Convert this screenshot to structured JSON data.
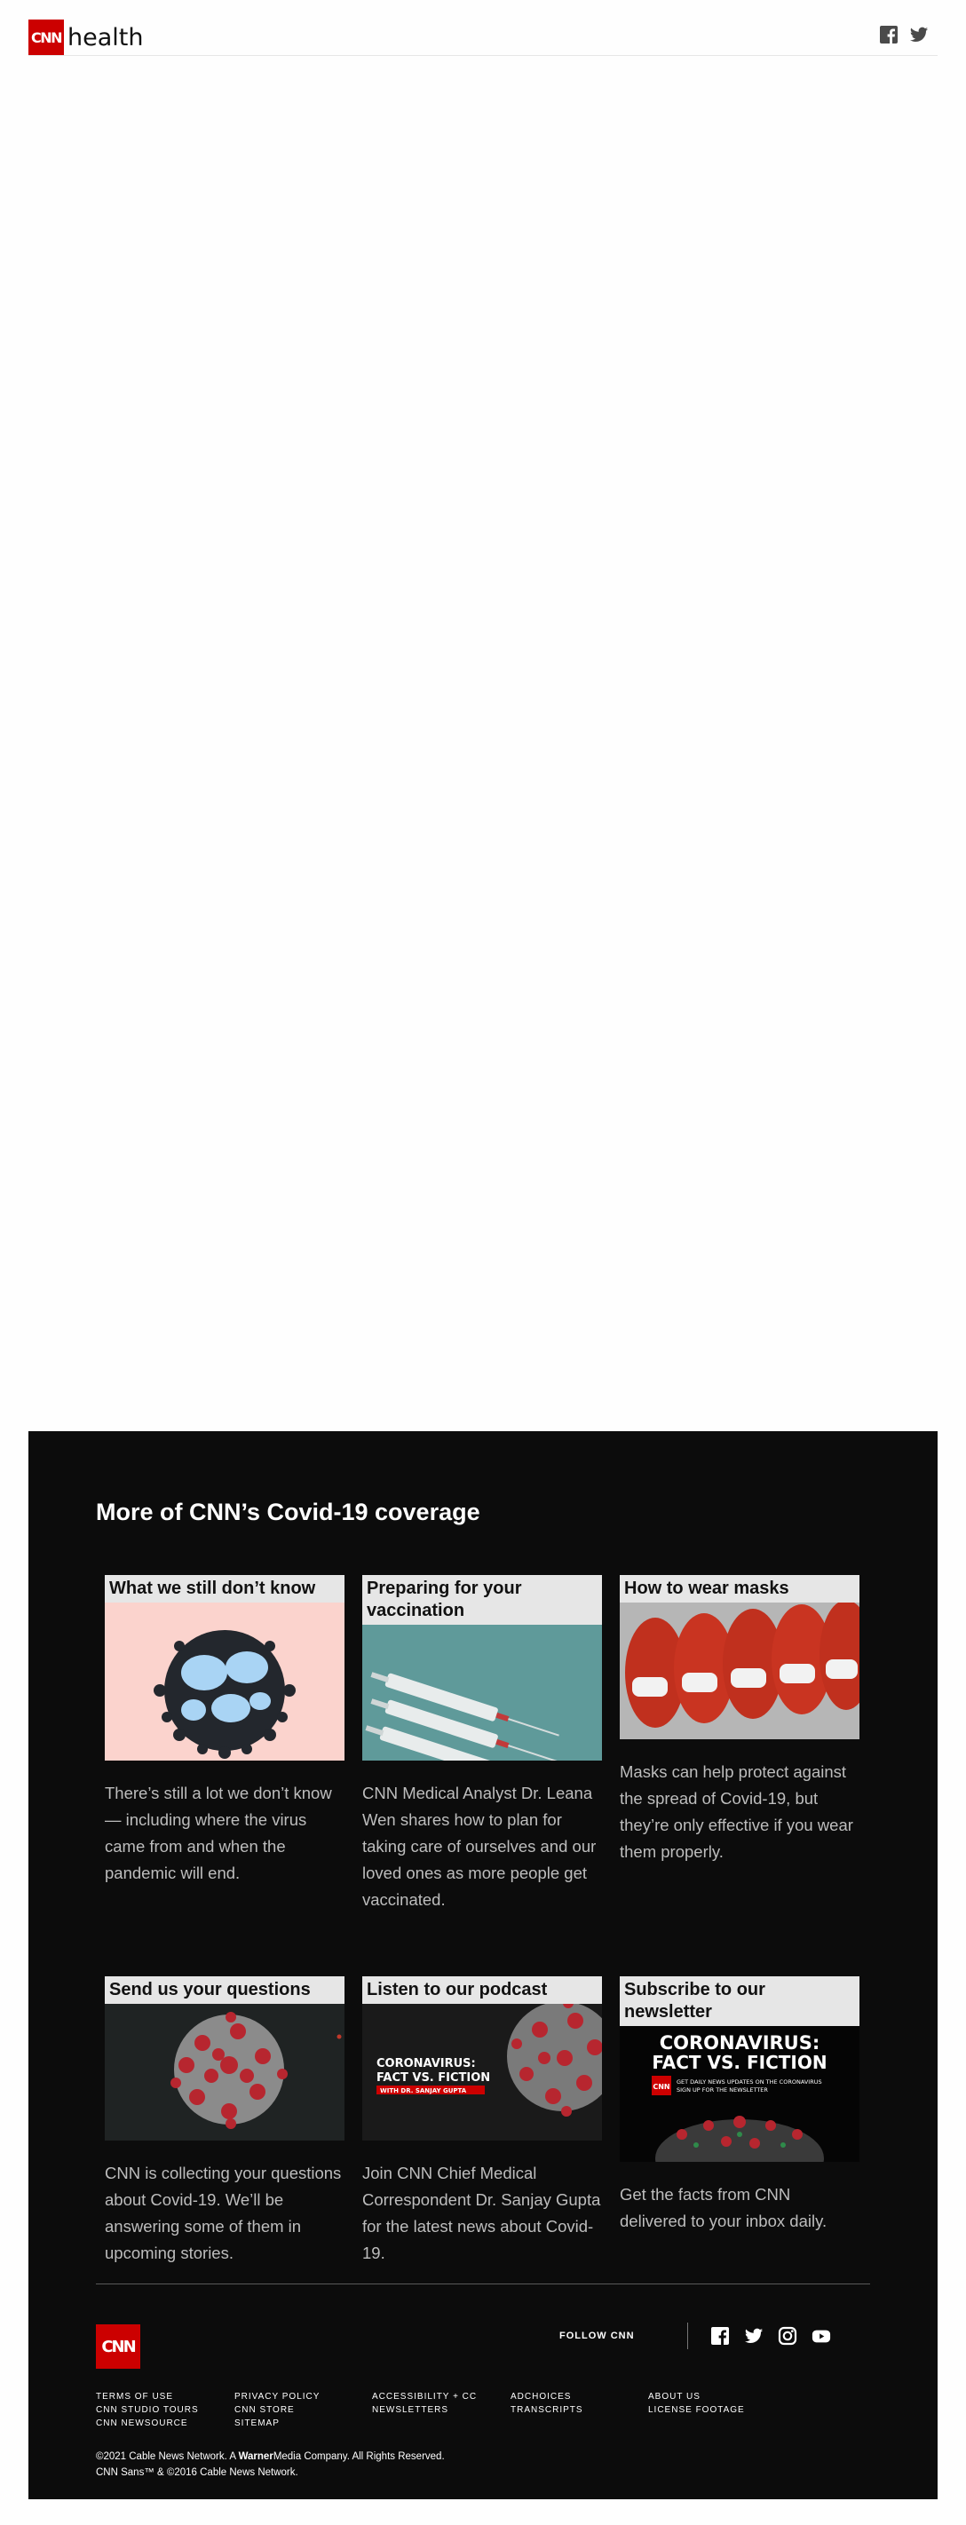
{
  "header": {
    "logo_text": "CNN",
    "section": "health",
    "social": [
      "facebook-icon",
      "twitter-icon"
    ]
  },
  "coverage": {
    "title": "More of CNN’s Covid-19 coverage",
    "cards": [
      {
        "title": "What we still don’t know",
        "desc": "There’s still a lot we don’t know — including where the virus came from and when the pandemic will end.",
        "image": "virus-illustration-pink"
      },
      {
        "title": "Preparing for your vaccination",
        "desc": "CNN Medical Analyst Dr. Leana Wen shares how to plan for taking care of ourselves and our loved ones as more people get vaccinated.",
        "image": "syringes-teal"
      },
      {
        "title": "How to wear masks",
        "desc": "Masks can help protect against the spread of Covid-19, but they’re only effective if you wear them properly.",
        "image": "masks-red"
      },
      {
        "title": "Send us your questions",
        "desc": "CNN is collecting your questions about Covid-19. We’ll be answering some of them in upcoming stories.",
        "image": "coronavirus-dark"
      },
      {
        "title": "Listen to our podcast",
        "desc": "Join CNN Chief Medical Correspondent Dr. Sanjay Gupta for the latest news about Covid-19.",
        "image": "podcast-art",
        "art_title_1": "CORONAVIRUS:",
        "art_title_2": "FACT VS. FICTION",
        "art_sub": "WITH DR. SANJAY GUPTA"
      },
      {
        "title": "Subscribe to our newsletter",
        "desc": "Get the facts from CNN delivered to your inbox daily.",
        "image": "newsletter-art",
        "art_title_1": "CORONAVIRUS:",
        "art_title_2": "FACT VS. FICTION",
        "art_sub_1": "GET DAILY NEWS UPDATES ON THE CORONAVIRUS",
        "art_sub_2": "SIGN UP FOR THE NEWSLETTER",
        "art_logo": "CNN"
      }
    ]
  },
  "footer": {
    "logo_text": "CNN",
    "follow_label": "FOLLOW CNN",
    "social": [
      "facebook-icon",
      "twitter-icon",
      "instagram-icon",
      "youtube-icon"
    ],
    "link_columns": [
      [
        "TERMS OF USE",
        "CNN STUDIO TOURS",
        "CNN NEWSOURCE"
      ],
      [
        "PRIVACY POLICY",
        "CNN STORE",
        "SITEMAP"
      ],
      [
        "ACCESSIBILITY + CC",
        "NEWSLETTERS"
      ],
      [
        "ADCHOICES",
        "TRANSCRIPTS"
      ],
      [
        "ABOUT US",
        "LICENSE FOOTAGE"
      ]
    ],
    "copyright_1_pre": "©2021 Cable News Network. A ",
    "copyright_1_brand_bold": "Warner",
    "copyright_1_brand_rest": "Media",
    "copyright_1_post": " Company. All Rights Reserved.",
    "copyright_2": "CNN Sans™ & ©2016 Cable News Network."
  }
}
